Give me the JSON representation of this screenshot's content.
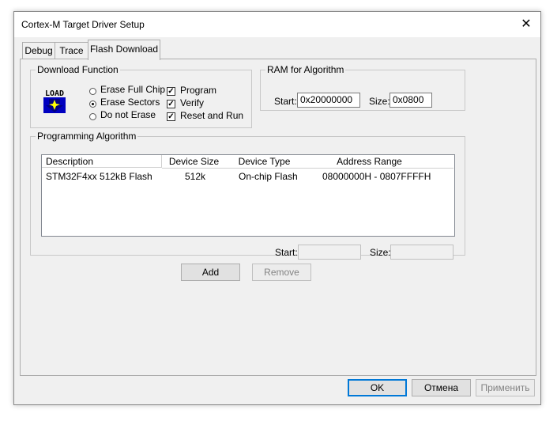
{
  "window": {
    "title": "Cortex-M Target Driver Setup"
  },
  "tabs": [
    {
      "label": "Debug",
      "active": false
    },
    {
      "label": "Trace",
      "active": false
    },
    {
      "label": "Flash Download",
      "active": true
    }
  ],
  "download_function": {
    "legend": "Download Function",
    "icon": "load-icon",
    "radios": [
      {
        "label": "Erase Full Chip",
        "checked": false
      },
      {
        "label": "Erase Sectors",
        "checked": true
      },
      {
        "label": "Do not Erase",
        "checked": false
      }
    ],
    "checkboxes": [
      {
        "label": "Program",
        "checked": true
      },
      {
        "label": "Verify",
        "checked": true
      },
      {
        "label": "Reset and Run",
        "checked": true
      }
    ],
    "icon_text": "LOAD"
  },
  "ram": {
    "legend": "RAM for Algorithm",
    "start_label": "Start:",
    "start_value": "0x20000000",
    "size_label": "Size:",
    "size_value": "0x0800"
  },
  "programming": {
    "legend": "Programming Algorithm",
    "columns": [
      "Description",
      "Device Size",
      "Device Type",
      "Address Range"
    ],
    "rows": [
      [
        "STM32F4xx 512kB Flash",
        "512k",
        "On-chip Flash",
        "08000000H - 0807FFFFH"
      ]
    ],
    "start_label": "Start:",
    "start_value": "",
    "size_label": "Size:",
    "size_value": ""
  },
  "buttons": {
    "add": "Add",
    "remove": "Remove",
    "ok": "OK",
    "cancel": "Отмена",
    "apply": "Применить"
  },
  "close_glyph": "✕",
  "check_glyph": "✓"
}
